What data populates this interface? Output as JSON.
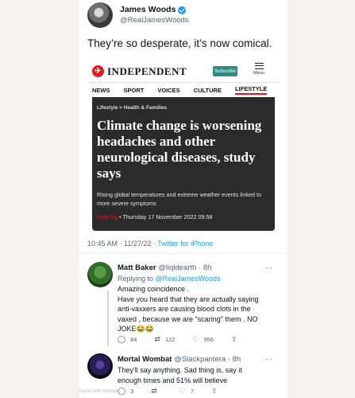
{
  "tweet": {
    "author_name": "James Woods",
    "author_handle": "@RealJamesWoods",
    "text": "They’re so desperate, it’s now comical.",
    "timestamp": "10:45 AM · 11/27/22 · ",
    "source": "Twitter for iPhone"
  },
  "article": {
    "logo_text": "INDEPENDENT",
    "subscribe_label": "Subscribe",
    "menu_label": "Menu",
    "nav": [
      "NEWS",
      "SPORT",
      "VOICES",
      "CULTURE",
      "LIFESTYLE"
    ],
    "breadcrumb": "Lifestyle > Health & Families",
    "headline": "Climate change is worsening headaches and other neurological diseases, study says",
    "standfirst": "Rising global temperatures and extreme weather events linked to more severe symptoms",
    "author": "Kate Ng",
    "date": "  •   Thursday 17 November 2022 09:58"
  },
  "replies": [
    {
      "name": "Matt Baker",
      "handle_time": " @liqidearth · 8h",
      "replying_to_label": "Replying to ",
      "replying_to": "@RealJamesWoods",
      "text_lines": [
        "Amazing coincidence .",
        "Have you heard that they are actually saying",
        "anti-vaxxers are causing blood clots in the",
        "vaxed , because we are \"scaring\" them . NO",
        "JOKE😂😂"
      ],
      "stats": {
        "replies": "84",
        "retweets": "122",
        "likes": "956"
      }
    },
    {
      "name": "Mortal Wombat",
      "handle_time": " @Slackpantera · 8h",
      "text_lines": [
        "They'll say anything. Sad thing is, say it",
        "enough times and 51% will believe"
      ],
      "stats": {
        "replies": "3",
        "retweets": "",
        "likes": "7"
      }
    }
  ],
  "watermark": "made with mematic"
}
